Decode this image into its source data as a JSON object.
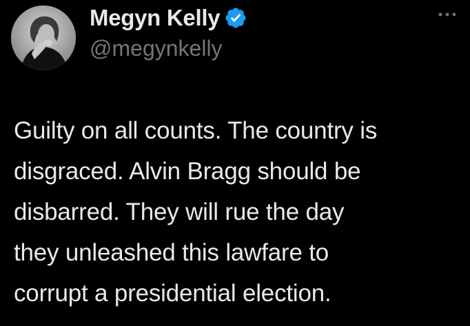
{
  "author": {
    "display_name": "Megyn Kelly",
    "handle": "@megynkelly",
    "verified": true,
    "verified_icon": "verified-badge-icon",
    "avatar_icon": "profile-photo"
  },
  "menu": {
    "icon": "more-options-icon"
  },
  "tweet": {
    "lines": [
      "Guilty on all counts. The country is",
      "disgraced. Alvin Bragg should be",
      "disbarred. They will rue the day",
      "they unleashed this lawfare to",
      "corrupt a presidential election."
    ]
  },
  "colors": {
    "background": "#000000",
    "text": "#e7e9ea",
    "secondary_text": "#71767b",
    "verified_blue": "#1d9bf0"
  }
}
